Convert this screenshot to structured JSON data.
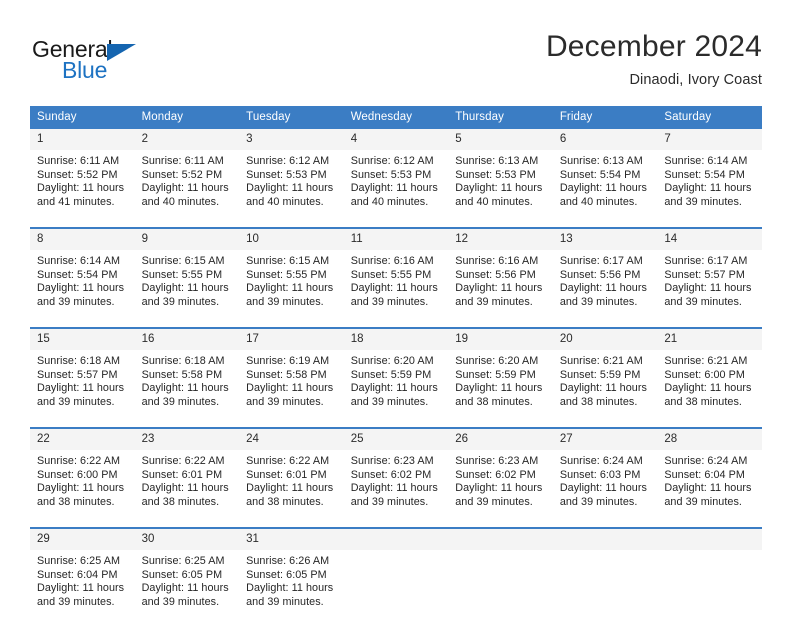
{
  "brand": {
    "name_dark": "General",
    "name_blue": "Blue",
    "accent_color": "#1d72c2",
    "triangle_color": "#1565b0"
  },
  "header": {
    "title": "December 2024",
    "location": "Dinaodi, Ivory Coast"
  },
  "calendar": {
    "header_bg": "#3b7dc4",
    "daynum_bg": "#f4f4f4",
    "weekdays": [
      "Sunday",
      "Monday",
      "Tuesday",
      "Wednesday",
      "Thursday",
      "Friday",
      "Saturday"
    ],
    "weeks": [
      [
        {
          "day": "1",
          "sunrise": "Sunrise: 6:11 AM",
          "sunset": "Sunset: 5:52 PM",
          "daylight1": "Daylight: 11 hours",
          "daylight2": "and 41 minutes."
        },
        {
          "day": "2",
          "sunrise": "Sunrise: 6:11 AM",
          "sunset": "Sunset: 5:52 PM",
          "daylight1": "Daylight: 11 hours",
          "daylight2": "and 40 minutes."
        },
        {
          "day": "3",
          "sunrise": "Sunrise: 6:12 AM",
          "sunset": "Sunset: 5:53 PM",
          "daylight1": "Daylight: 11 hours",
          "daylight2": "and 40 minutes."
        },
        {
          "day": "4",
          "sunrise": "Sunrise: 6:12 AM",
          "sunset": "Sunset: 5:53 PM",
          "daylight1": "Daylight: 11 hours",
          "daylight2": "and 40 minutes."
        },
        {
          "day": "5",
          "sunrise": "Sunrise: 6:13 AM",
          "sunset": "Sunset: 5:53 PM",
          "daylight1": "Daylight: 11 hours",
          "daylight2": "and 40 minutes."
        },
        {
          "day": "6",
          "sunrise": "Sunrise: 6:13 AM",
          "sunset": "Sunset: 5:54 PM",
          "daylight1": "Daylight: 11 hours",
          "daylight2": "and 40 minutes."
        },
        {
          "day": "7",
          "sunrise": "Sunrise: 6:14 AM",
          "sunset": "Sunset: 5:54 PM",
          "daylight1": "Daylight: 11 hours",
          "daylight2": "and 39 minutes."
        }
      ],
      [
        {
          "day": "8",
          "sunrise": "Sunrise: 6:14 AM",
          "sunset": "Sunset: 5:54 PM",
          "daylight1": "Daylight: 11 hours",
          "daylight2": "and 39 minutes."
        },
        {
          "day": "9",
          "sunrise": "Sunrise: 6:15 AM",
          "sunset": "Sunset: 5:55 PM",
          "daylight1": "Daylight: 11 hours",
          "daylight2": "and 39 minutes."
        },
        {
          "day": "10",
          "sunrise": "Sunrise: 6:15 AM",
          "sunset": "Sunset: 5:55 PM",
          "daylight1": "Daylight: 11 hours",
          "daylight2": "and 39 minutes."
        },
        {
          "day": "11",
          "sunrise": "Sunrise: 6:16 AM",
          "sunset": "Sunset: 5:55 PM",
          "daylight1": "Daylight: 11 hours",
          "daylight2": "and 39 minutes."
        },
        {
          "day": "12",
          "sunrise": "Sunrise: 6:16 AM",
          "sunset": "Sunset: 5:56 PM",
          "daylight1": "Daylight: 11 hours",
          "daylight2": "and 39 minutes."
        },
        {
          "day": "13",
          "sunrise": "Sunrise: 6:17 AM",
          "sunset": "Sunset: 5:56 PM",
          "daylight1": "Daylight: 11 hours",
          "daylight2": "and 39 minutes."
        },
        {
          "day": "14",
          "sunrise": "Sunrise: 6:17 AM",
          "sunset": "Sunset: 5:57 PM",
          "daylight1": "Daylight: 11 hours",
          "daylight2": "and 39 minutes."
        }
      ],
      [
        {
          "day": "15",
          "sunrise": "Sunrise: 6:18 AM",
          "sunset": "Sunset: 5:57 PM",
          "daylight1": "Daylight: 11 hours",
          "daylight2": "and 39 minutes."
        },
        {
          "day": "16",
          "sunrise": "Sunrise: 6:18 AM",
          "sunset": "Sunset: 5:58 PM",
          "daylight1": "Daylight: 11 hours",
          "daylight2": "and 39 minutes."
        },
        {
          "day": "17",
          "sunrise": "Sunrise: 6:19 AM",
          "sunset": "Sunset: 5:58 PM",
          "daylight1": "Daylight: 11 hours",
          "daylight2": "and 39 minutes."
        },
        {
          "day": "18",
          "sunrise": "Sunrise: 6:20 AM",
          "sunset": "Sunset: 5:59 PM",
          "daylight1": "Daylight: 11 hours",
          "daylight2": "and 39 minutes."
        },
        {
          "day": "19",
          "sunrise": "Sunrise: 6:20 AM",
          "sunset": "Sunset: 5:59 PM",
          "daylight1": "Daylight: 11 hours",
          "daylight2": "and 38 minutes."
        },
        {
          "day": "20",
          "sunrise": "Sunrise: 6:21 AM",
          "sunset": "Sunset: 5:59 PM",
          "daylight1": "Daylight: 11 hours",
          "daylight2": "and 38 minutes."
        },
        {
          "day": "21",
          "sunrise": "Sunrise: 6:21 AM",
          "sunset": "Sunset: 6:00 PM",
          "daylight1": "Daylight: 11 hours",
          "daylight2": "and 38 minutes."
        }
      ],
      [
        {
          "day": "22",
          "sunrise": "Sunrise: 6:22 AM",
          "sunset": "Sunset: 6:00 PM",
          "daylight1": "Daylight: 11 hours",
          "daylight2": "and 38 minutes."
        },
        {
          "day": "23",
          "sunrise": "Sunrise: 6:22 AM",
          "sunset": "Sunset: 6:01 PM",
          "daylight1": "Daylight: 11 hours",
          "daylight2": "and 38 minutes."
        },
        {
          "day": "24",
          "sunrise": "Sunrise: 6:22 AM",
          "sunset": "Sunset: 6:01 PM",
          "daylight1": "Daylight: 11 hours",
          "daylight2": "and 38 minutes."
        },
        {
          "day": "25",
          "sunrise": "Sunrise: 6:23 AM",
          "sunset": "Sunset: 6:02 PM",
          "daylight1": "Daylight: 11 hours",
          "daylight2": "and 39 minutes."
        },
        {
          "day": "26",
          "sunrise": "Sunrise: 6:23 AM",
          "sunset": "Sunset: 6:02 PM",
          "daylight1": "Daylight: 11 hours",
          "daylight2": "and 39 minutes."
        },
        {
          "day": "27",
          "sunrise": "Sunrise: 6:24 AM",
          "sunset": "Sunset: 6:03 PM",
          "daylight1": "Daylight: 11 hours",
          "daylight2": "and 39 minutes."
        },
        {
          "day": "28",
          "sunrise": "Sunrise: 6:24 AM",
          "sunset": "Sunset: 6:04 PM",
          "daylight1": "Daylight: 11 hours",
          "daylight2": "and 39 minutes."
        }
      ],
      [
        {
          "day": "29",
          "sunrise": "Sunrise: 6:25 AM",
          "sunset": "Sunset: 6:04 PM",
          "daylight1": "Daylight: 11 hours",
          "daylight2": "and 39 minutes."
        },
        {
          "day": "30",
          "sunrise": "Sunrise: 6:25 AM",
          "sunset": "Sunset: 6:05 PM",
          "daylight1": "Daylight: 11 hours",
          "daylight2": "and 39 minutes."
        },
        {
          "day": "31",
          "sunrise": "Sunrise: 6:26 AM",
          "sunset": "Sunset: 6:05 PM",
          "daylight1": "Daylight: 11 hours",
          "daylight2": "and 39 minutes."
        },
        {
          "day": "",
          "sunrise": "",
          "sunset": "",
          "daylight1": "",
          "daylight2": ""
        },
        {
          "day": "",
          "sunrise": "",
          "sunset": "",
          "daylight1": "",
          "daylight2": ""
        },
        {
          "day": "",
          "sunrise": "",
          "sunset": "",
          "daylight1": "",
          "daylight2": ""
        },
        {
          "day": "",
          "sunrise": "",
          "sunset": "",
          "daylight1": "",
          "daylight2": ""
        }
      ]
    ]
  }
}
